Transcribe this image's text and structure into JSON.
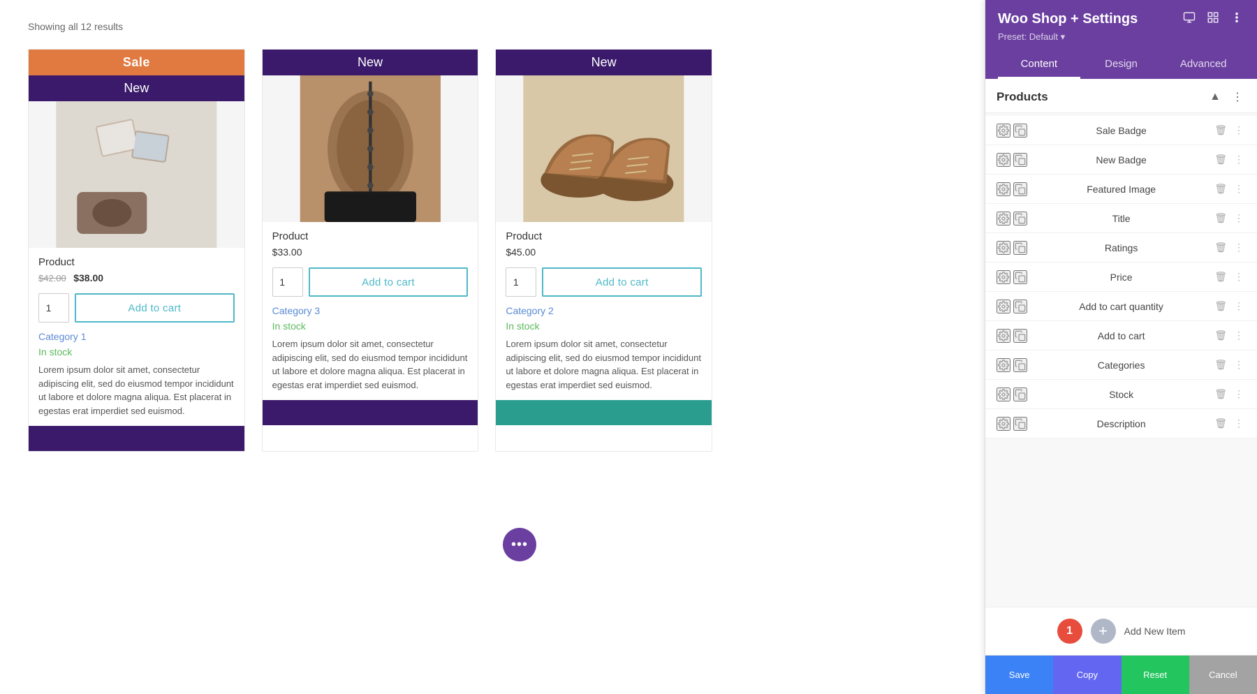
{
  "meta": {
    "showing_results": "Showing all 12 results"
  },
  "products": [
    {
      "id": 1,
      "name": "Product",
      "price_old": "$42.00",
      "price_new": "$38.00",
      "has_sale_badge": true,
      "has_new_badge": true,
      "sale_badge_text": "Sale",
      "new_badge_text": "New",
      "category": "Category 1",
      "stock": "In stock",
      "description": "Lorem ipsum dolor sit amet, consectetur adipiscing elit, sed do eiusmod tempor incididunt ut labore et dolore magna aliqua. Est placerat in egestas erat imperdiet sed euismod.",
      "qty": "1",
      "image_type": "product1"
    },
    {
      "id": 2,
      "name": "Product",
      "price": "$33.00",
      "has_sale_badge": false,
      "has_new_badge": true,
      "new_badge_text": "New",
      "category": "Category 3",
      "stock": "In stock",
      "description": "Lorem ipsum dolor sit amet, consectetur adipiscing elit, sed do eiusmod tempor incididunt ut labore et dolore magna aliqua. Est placerat in egestas erat imperdiet sed euismod.",
      "qty": "1",
      "image_type": "product2"
    },
    {
      "id": 3,
      "name": "Product",
      "price": "$45.00",
      "has_sale_badge": false,
      "has_new_badge": true,
      "new_badge_text": "New",
      "category": "Category 2",
      "stock": "In stock",
      "description": "Lorem ipsum dolor sit amet, consectetur adipiscing elit, sed do eiusmod tempor incididunt ut labore et dolore magna aliqua. Est placerat in egestas erat imperdiet sed euismod.",
      "qty": "1",
      "image_type": "product3"
    }
  ],
  "fab": {
    "dots": "•••"
  },
  "panel": {
    "title": "Woo Shop + Settings",
    "preset_label": "Preset: Default",
    "tabs": [
      {
        "id": "content",
        "label": "Content",
        "active": true
      },
      {
        "id": "design",
        "label": "Design",
        "active": false
      },
      {
        "id": "advanced",
        "label": "Advanced",
        "active": false
      }
    ],
    "section_title": "Products",
    "modules": [
      {
        "id": "sale-badge",
        "name": "Sale Badge"
      },
      {
        "id": "new-badge",
        "name": "New Badge"
      },
      {
        "id": "featured-image",
        "name": "Featured Image"
      },
      {
        "id": "title",
        "name": "Title"
      },
      {
        "id": "ratings",
        "name": "Ratings"
      },
      {
        "id": "price",
        "name": "Price"
      },
      {
        "id": "add-to-cart-quantity",
        "name": "Add to cart quantity"
      },
      {
        "id": "add-to-cart",
        "name": "Add to cart"
      },
      {
        "id": "categories",
        "name": "Categories"
      },
      {
        "id": "stock",
        "name": "Stock"
      },
      {
        "id": "description",
        "name": "Description"
      }
    ],
    "footer": {
      "badge_number": "1",
      "add_item_label": "Add New Item"
    },
    "bottom_bar": {
      "save": "Save",
      "copy": "Copy",
      "reset": "Reset",
      "cancel": "Cancel"
    }
  },
  "add_to_cart_label": "Add to cart"
}
